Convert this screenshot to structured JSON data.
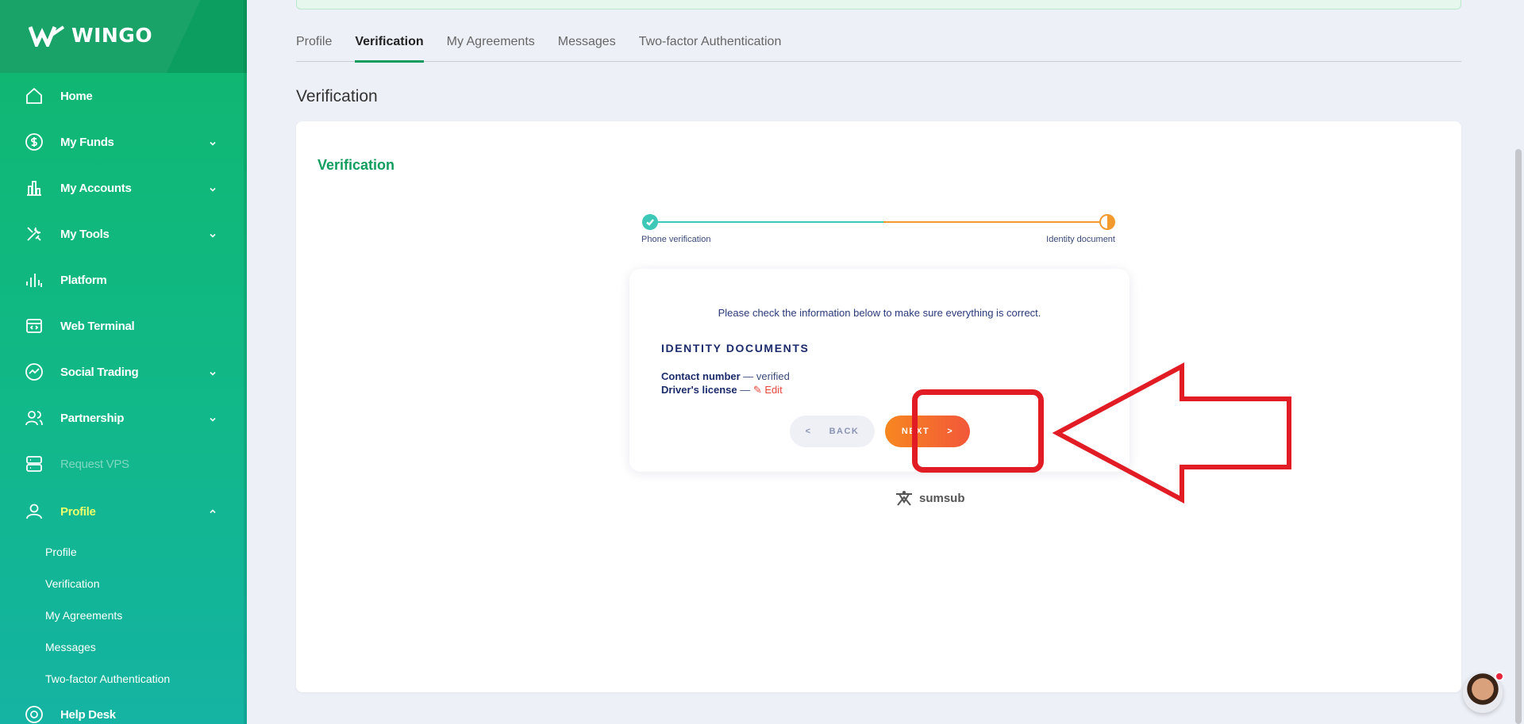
{
  "brand": {
    "name": "WINGO"
  },
  "sidebar": {
    "items": [
      {
        "label": "Home",
        "icon": "home-icon"
      },
      {
        "label": "My Funds",
        "icon": "dollar-icon"
      },
      {
        "label": "My Accounts",
        "icon": "accounts-icon"
      },
      {
        "label": "My Tools",
        "icon": "tools-icon"
      },
      {
        "label": "Platform",
        "icon": "chart-bars-icon"
      },
      {
        "label": "Web Terminal",
        "icon": "terminal-icon"
      },
      {
        "label": "Social Trading",
        "icon": "trend-icon"
      },
      {
        "label": "Partnership",
        "icon": "users-icon"
      },
      {
        "label": "Request VPS",
        "icon": "server-icon"
      },
      {
        "label": "Profile",
        "icon": "user-icon"
      }
    ],
    "profile_subitems": [
      "Profile",
      "Verification",
      "My Agreements",
      "Messages",
      "Two-factor Authentication"
    ],
    "help": {
      "label": "Help Desk",
      "icon": "help-icon"
    }
  },
  "tabs": [
    "Profile",
    "Verification",
    "My Agreements",
    "Messages",
    "Two-factor Authentication"
  ],
  "active_tab": "Verification",
  "page_title": "Verification",
  "card": {
    "title": "Verification",
    "steps": [
      "Phone verification",
      "Identity document"
    ],
    "info_text": "Please check the information below to make sure everything is correct.",
    "section_heading": "IDENTITY DOCUMENTS",
    "contact_label": "Contact number",
    "contact_sep": " — ",
    "contact_status": "verified",
    "license_label": "Driver's license",
    "license_sep": " — ",
    "edit_label": "Edit",
    "back_label": "BACK",
    "back_arrow": "<",
    "next_label": "NEXT",
    "next_arrow": ">",
    "provider": "sumsub"
  },
  "colors": {
    "brand_green": "#0fb76e",
    "accent_orange": "#f7871f",
    "annotation_red": "#e21c24",
    "step_teal": "#3cc7b7"
  }
}
